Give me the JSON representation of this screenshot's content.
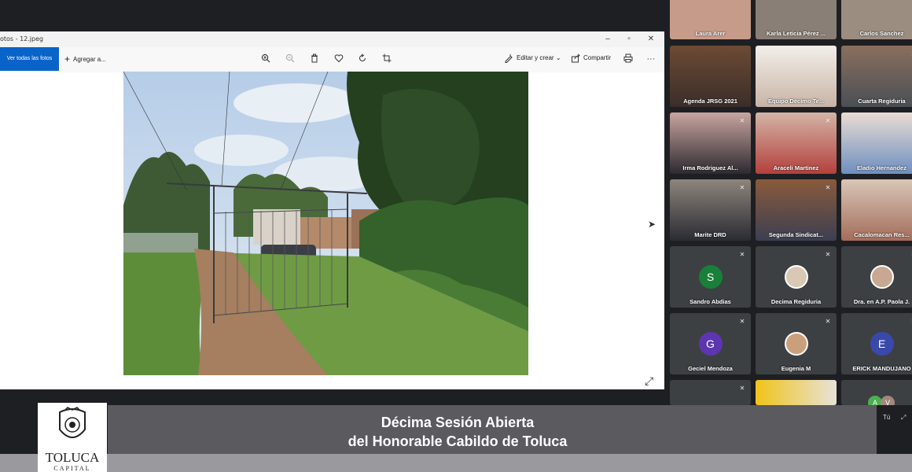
{
  "window": {
    "title": "otos - 12.jpeg",
    "view_all_label": "Ver todas las fotos",
    "add_label": "Agregar a...",
    "edit_label": "Editar y crear",
    "share_label": "Compartir",
    "accent": "#0a63c9"
  },
  "participants": [
    {
      "name": "Laura Arer",
      "muted": false
    },
    {
      "name": "Karla Leticia Pérez ...",
      "muted": false
    },
    {
      "name": "Carlos Sanchez",
      "muted": false
    },
    {
      "name": "Agenda JRSG 2021",
      "muted": false
    },
    {
      "name": "Equipo Décimo Te...",
      "muted": true
    },
    {
      "name": "Cuarta Regiduria",
      "muted": true
    },
    {
      "name": "Irma Rodriguez Al...",
      "muted": true
    },
    {
      "name": "Araceli Martinez",
      "muted": true
    },
    {
      "name": "Eladio Hernandez",
      "muted": false
    },
    {
      "name": "Marite DRD",
      "muted": true
    },
    {
      "name": "Segunda Sindicat...",
      "muted": true
    },
    {
      "name": "Cacalomacan Res...",
      "muted": false
    },
    {
      "name": "Sandro Abdias",
      "initial": "S",
      "color": "#188038",
      "muted": true
    },
    {
      "name": "Decima Regiduria",
      "muted": true
    },
    {
      "name": "Dra. en A.P. Paola J.",
      "muted": true
    },
    {
      "name": "Geciel Mendoza",
      "initial": "G",
      "color": "#5e35b1",
      "muted": true
    },
    {
      "name": "Eugenia M",
      "muted": true
    },
    {
      "name": "ERICK MANDUJANO",
      "initial": "E",
      "color": "#3949ab",
      "muted": true
    }
  ],
  "mini_tile": {
    "initials_a": "A",
    "initials_v": "V",
    "you_label": "Tú"
  },
  "banner": {
    "line1": "Décima Sesión Abierta",
    "line2": "del Honorable Cabildo de Toluca"
  },
  "logo": {
    "word1": "TOLUCA",
    "word2": "CAPITAL"
  }
}
